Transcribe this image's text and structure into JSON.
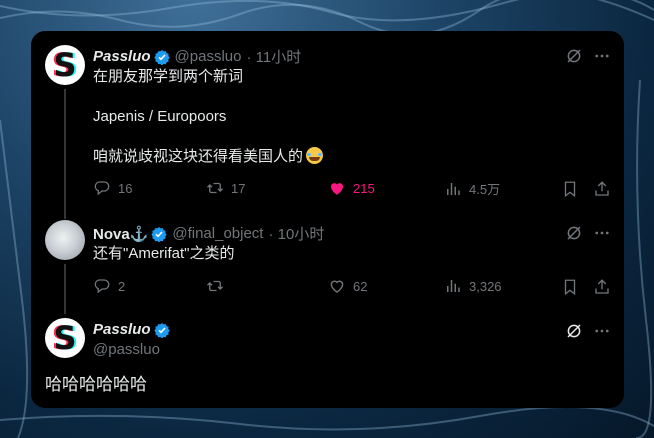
{
  "colors": {
    "accent_blue": "#1d9bf0",
    "like_pink": "#f91880",
    "muted": "#71767b",
    "text": "#e7e9ea"
  },
  "tweets": [
    {
      "avatar_icon": "s-logo-avatar",
      "name": "Passluo",
      "handle": "@passluo",
      "time": "· 11小时",
      "lines": [
        "在朋友那学到两个新词",
        "Japenis / Europoors",
        "咱就说歧视这块还得看美国人的"
      ],
      "emoji": "face-with-tears-of-joy",
      "replies": "16",
      "retweets": "17",
      "likes": "215",
      "views": "4.5万"
    },
    {
      "avatar_icon": "nova-avatar",
      "name": "Nova⚓",
      "handle": "@final_object",
      "time": "· 10小时",
      "lines": [
        "还有\"Amerifat\"之类的"
      ],
      "replies": "2",
      "retweets": "",
      "likes": "62",
      "views": "3,326"
    },
    {
      "avatar_icon": "s-logo-avatar",
      "name": "Passluo",
      "handle": "@passluo",
      "lines": [
        "哈哈哈哈哈哈"
      ]
    }
  ]
}
